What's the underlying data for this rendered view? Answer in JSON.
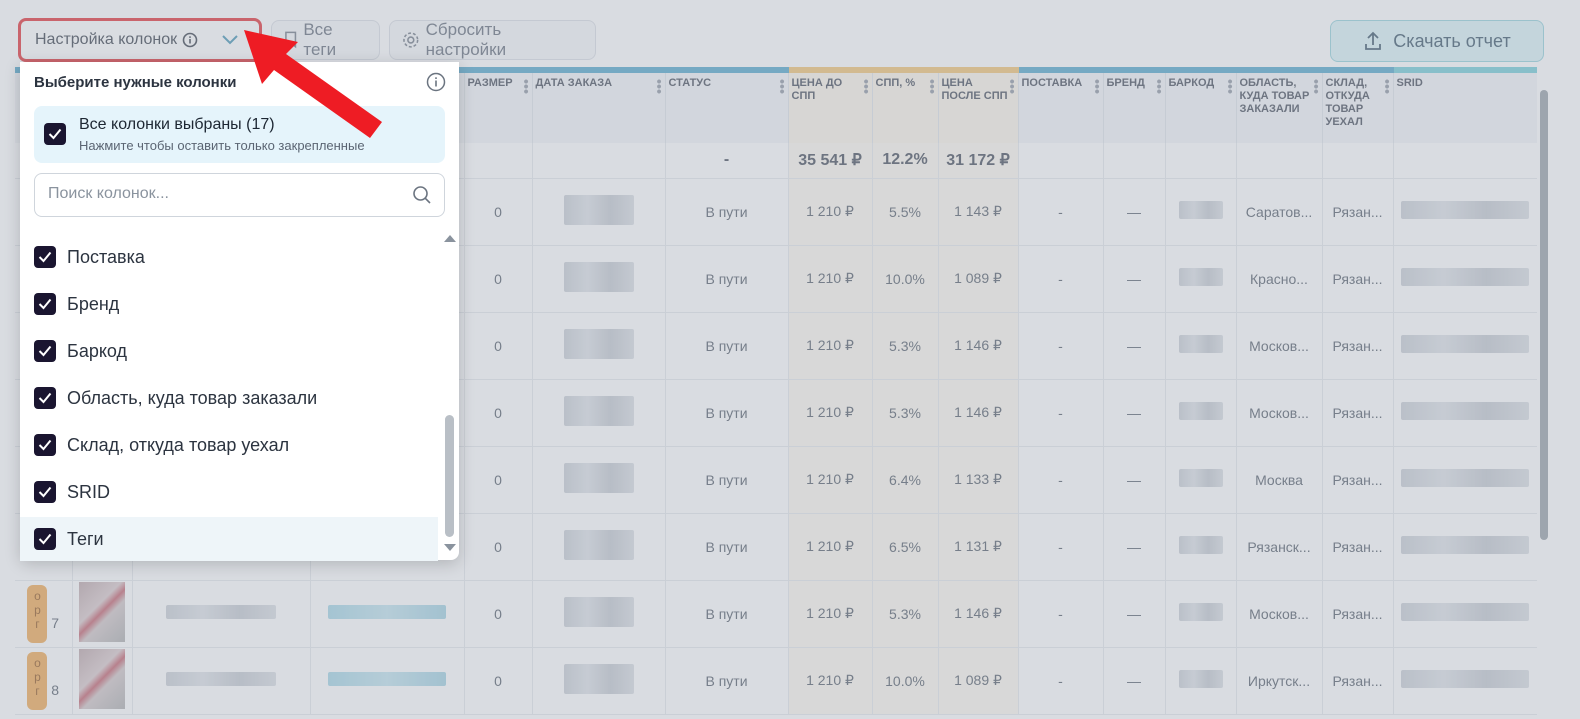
{
  "toolbar": {
    "column_settings_label": "Настройка колонок",
    "all_tags_label": "Все теги",
    "reset_label": "Сбросить настройки",
    "download_label": "Скачать отчет"
  },
  "table": {
    "headers": [
      {
        "label": "",
        "style": "plain"
      },
      {
        "label": "",
        "style": "plain"
      },
      {
        "label": "",
        "style": "plain"
      },
      {
        "label": "",
        "style": "plain"
      },
      {
        "label": "РАЗМЕР",
        "style": "plain"
      },
      {
        "label": "ДАТА ЗАКАЗА",
        "style": "plain"
      },
      {
        "label": "СТАТУС",
        "style": "plain"
      },
      {
        "label": "ЦЕНА ДО СПП",
        "style": "amber"
      },
      {
        "label": "СПП, %",
        "style": "amber"
      },
      {
        "label": "ЦЕНА ПОСЛЕ СПП",
        "style": "amber"
      },
      {
        "label": "ПОСТАВКА",
        "style": "plain"
      },
      {
        "label": "БРЕНД",
        "style": "plain"
      },
      {
        "label": "БАРКОД",
        "style": "plain"
      },
      {
        "label": "ОБЛАСТЬ, КУДА ТОВАР ЗАКАЗАЛИ",
        "style": "plain"
      },
      {
        "label": "СКЛАД, ОТКУДА ТОВАР УЕХАЛ",
        "style": "plain"
      },
      {
        "label": "SRID",
        "style": "teal"
      }
    ],
    "totals": {
      "status": "-",
      "price_before": "35 541 ₽",
      "spp": "12.2%",
      "price_after": "31 172 ₽"
    },
    "rows": [
      {
        "num": "",
        "size": "0",
        "status": "В пути",
        "price_before": "1 210 ₽",
        "spp": "5.5%",
        "price_after": "1 143 ₽",
        "supply": "-",
        "brand": "—",
        "region": "Саратов...",
        "warehouse": "Рязан..."
      },
      {
        "num": "",
        "size": "0",
        "status": "В пути",
        "price_before": "1 210 ₽",
        "spp": "10.0%",
        "price_after": "1 089 ₽",
        "supply": "-",
        "brand": "—",
        "region": "Красно...",
        "warehouse": "Рязан..."
      },
      {
        "num": "",
        "size": "0",
        "status": "В пути",
        "price_before": "1 210 ₽",
        "spp": "5.3%",
        "price_after": "1 146 ₽",
        "supply": "-",
        "brand": "—",
        "region": "Москов...",
        "warehouse": "Рязан..."
      },
      {
        "num": "",
        "size": "0",
        "status": "В пути",
        "price_before": "1 210 ₽",
        "spp": "5.3%",
        "price_after": "1 146 ₽",
        "supply": "-",
        "brand": "—",
        "region": "Москов...",
        "warehouse": "Рязан..."
      },
      {
        "num": "",
        "size": "0",
        "status": "В пути",
        "price_before": "1 210 ₽",
        "spp": "6.4%",
        "price_after": "1 133 ₽",
        "supply": "-",
        "brand": "—",
        "region": "Москва",
        "warehouse": "Рязан..."
      },
      {
        "num": "",
        "size": "0",
        "status": "В пути",
        "price_before": "1 210 ₽",
        "spp": "6.5%",
        "price_after": "1 131 ₽",
        "supply": "-",
        "brand": "—",
        "region": "Рязанск...",
        "warehouse": "Рязан..."
      },
      {
        "num": "7",
        "tag": "о\nр\nг",
        "size": "0",
        "status": "В пути",
        "price_before": "1 210 ₽",
        "spp": "5.3%",
        "price_after": "1 146 ₽",
        "supply": "-",
        "brand": "—",
        "region": "Москов...",
        "warehouse": "Рязан..."
      },
      {
        "num": "8",
        "tag": "о\nр\nг",
        "size": "0",
        "status": "В пути",
        "price_before": "1 210 ₽",
        "spp": "10.0%",
        "price_after": "1 089 ₽",
        "supply": "-",
        "brand": "—",
        "region": "Иркутск...",
        "warehouse": "Рязан..."
      }
    ]
  },
  "panel": {
    "title": "Выберите нужные колонки",
    "all_selected_title": "Все колонки выбраны (17)",
    "all_selected_hint": "Нажмите чтобы оставить только закрепленные",
    "search_placeholder": "Поиск колонок...",
    "items": [
      {
        "label": "Поставка",
        "checked": true
      },
      {
        "label": "Бренд",
        "checked": true
      },
      {
        "label": "Баркод",
        "checked": true
      },
      {
        "label": "Область, куда товар заказали",
        "checked": true
      },
      {
        "label": "Склад, откуда товар уехал",
        "checked": true
      },
      {
        "label": "SRID",
        "checked": true
      },
      {
        "label": "Теги",
        "checked": true
      }
    ]
  },
  "colors": {
    "accent_red": "#e2262b",
    "checkbox": "#1a1530",
    "header_blue": "#4aa3c8",
    "header_amber": "#f2c16c"
  }
}
